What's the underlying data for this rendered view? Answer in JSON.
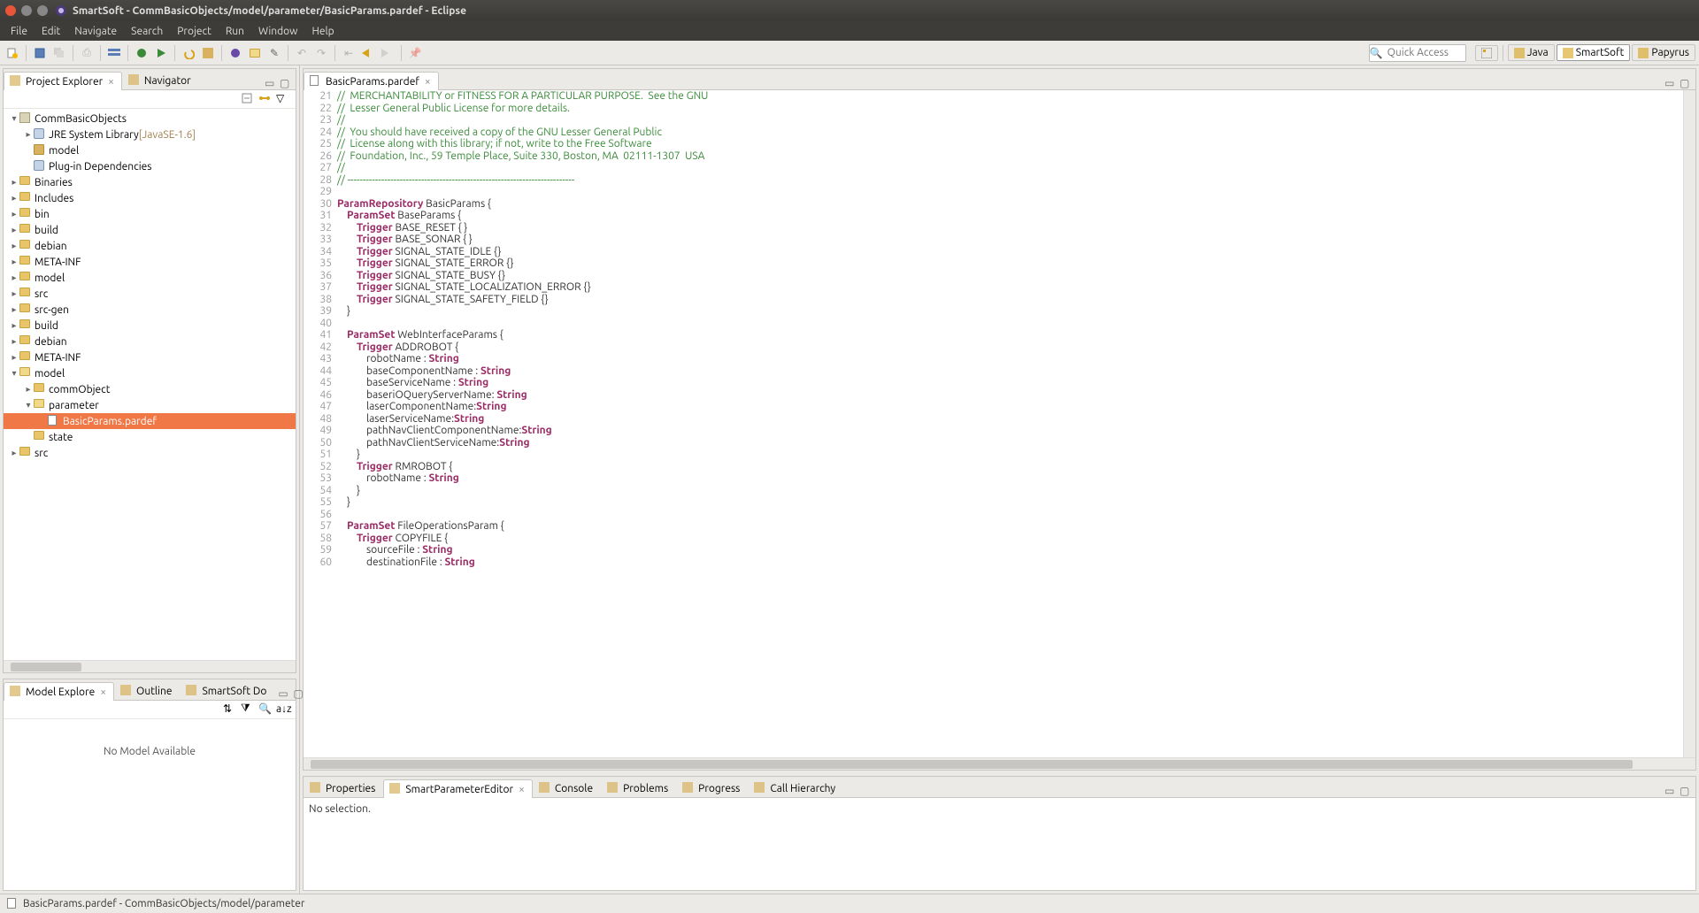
{
  "window": {
    "title": "SmartSoft - CommBasicObjects/model/parameter/BasicParams.pardef - Eclipse"
  },
  "menu": [
    "File",
    "Edit",
    "Navigate",
    "Search",
    "Project",
    "Run",
    "Window",
    "Help"
  ],
  "quickaccess_placeholder": "Quick Access",
  "perspectives": [
    {
      "name": "Java",
      "active": false
    },
    {
      "name": "SmartSoft",
      "active": true
    },
    {
      "name": "Papyrus",
      "active": false
    }
  ],
  "left_top_tabs": [
    {
      "label": "Project Explorer",
      "active": true,
      "closable": true
    },
    {
      "label": "Navigator",
      "active": false,
      "closable": false
    }
  ],
  "tree": [
    {
      "d": 0,
      "tw": "▾",
      "icon": "proj",
      "label": "CommBasicObjects"
    },
    {
      "d": 1,
      "tw": "▸",
      "icon": "jar",
      "label": "JRE System Library",
      "suffix": "[JavaSE-1.6]"
    },
    {
      "d": 1,
      "tw": "",
      "icon": "pkg",
      "label": "model"
    },
    {
      "d": 1,
      "tw": "",
      "icon": "jar",
      "label": "Plug-in Dependencies"
    },
    {
      "d": 0,
      "tw": "▸",
      "icon": "folder",
      "label": "Binaries"
    },
    {
      "d": 0,
      "tw": "▸",
      "icon": "folder",
      "label": "Includes"
    },
    {
      "d": 0,
      "tw": "▸",
      "icon": "folder",
      "label": "bin"
    },
    {
      "d": 0,
      "tw": "▸",
      "icon": "folder",
      "label": "build"
    },
    {
      "d": 0,
      "tw": "▸",
      "icon": "folder",
      "label": "debian"
    },
    {
      "d": 0,
      "tw": "▸",
      "icon": "folder",
      "label": "META-INF"
    },
    {
      "d": 0,
      "tw": "▸",
      "icon": "folder",
      "label": "model"
    },
    {
      "d": 0,
      "tw": "▸",
      "icon": "folder",
      "label": "src"
    },
    {
      "d": 0,
      "tw": "▸",
      "icon": "folder",
      "label": "src-gen"
    },
    {
      "d": 0,
      "tw": "▸",
      "icon": "folder",
      "label": "build"
    },
    {
      "d": 0,
      "tw": "▸",
      "icon": "folder",
      "label": "debian"
    },
    {
      "d": 0,
      "tw": "▸",
      "icon": "folder",
      "label": "META-INF"
    },
    {
      "d": 0,
      "tw": "▾",
      "icon": "folder-open",
      "label": "model"
    },
    {
      "d": 1,
      "tw": "▸",
      "icon": "folder",
      "label": "commObject"
    },
    {
      "d": 1,
      "tw": "▾",
      "icon": "folder-open",
      "label": "parameter"
    },
    {
      "d": 2,
      "tw": "",
      "icon": "file",
      "label": "BasicParams.pardef",
      "selected": true
    },
    {
      "d": 1,
      "tw": "",
      "icon": "folder",
      "label": "state"
    },
    {
      "d": 0,
      "tw": "▸",
      "icon": "folder",
      "label": "src"
    }
  ],
  "left_bottom_tabs": [
    {
      "label": "Model Explore",
      "active": true,
      "closable": true
    },
    {
      "label": "Outline",
      "active": false,
      "closable": false
    },
    {
      "label": "SmartSoft Do",
      "active": false,
      "closable": false
    }
  ],
  "model_explorer_text": "No Model Available",
  "editor_tab": "BasicParams.pardef",
  "code_lines": [
    {
      "n": 21,
      "html": "<span class='cm'>//  MERCHANTABILITY or FITNESS FOR A PARTICULAR PURPOSE.  See the GNU</span>"
    },
    {
      "n": 22,
      "html": "<span class='cm'>//  Lesser General Public License for more details.</span>"
    },
    {
      "n": 23,
      "html": "<span class='cm'>//</span>"
    },
    {
      "n": 24,
      "html": "<span class='cm'>//  You should have received a copy of the GNU Lesser General Public</span>"
    },
    {
      "n": 25,
      "html": "<span class='cm'>//  License along with this library; if not, write to the Free Software</span>"
    },
    {
      "n": 26,
      "html": "<span class='cm'>//  Foundation, Inc., 59 Temple Place, Suite 330, Boston, MA  02111-1307  USA</span>"
    },
    {
      "n": 27,
      "html": "<span class='cm'>//</span>"
    },
    {
      "n": 28,
      "html": "<span class='cm'>// --------------------------------------------------------------------------</span>"
    },
    {
      "n": 29,
      "html": ""
    },
    {
      "n": 30,
      "fold": true,
      "html": "<span class='kw'>ParamRepository</span> BasicParams {"
    },
    {
      "n": 31,
      "fold": true,
      "html": "    <span class='kw'>ParamSet</span> BaseParams {"
    },
    {
      "n": 32,
      "html": "        <span class='kw'>Trigger</span> BASE_RESET { }"
    },
    {
      "n": 33,
      "html": "        <span class='kw'>Trigger</span> BASE_SONAR { }"
    },
    {
      "n": 34,
      "html": "        <span class='kw'>Trigger</span> SIGNAL_STATE_IDLE {}"
    },
    {
      "n": 35,
      "html": "        <span class='kw'>Trigger</span> SIGNAL_STATE_ERROR {}"
    },
    {
      "n": 36,
      "html": "        <span class='kw'>Trigger</span> SIGNAL_STATE_BUSY {}"
    },
    {
      "n": 37,
      "html": "        <span class='kw'>Trigger</span> SIGNAL_STATE_LOCALIZATION_ERROR {}"
    },
    {
      "n": 38,
      "html": "        <span class='kw'>Trigger</span> SIGNAL_STATE_SAFETY_FIELD {}"
    },
    {
      "n": 39,
      "html": "    }"
    },
    {
      "n": 40,
      "html": ""
    },
    {
      "n": 41,
      "fold": true,
      "html": "    <span class='kw'>ParamSet</span> WebInterfaceParams {"
    },
    {
      "n": 42,
      "fold": true,
      "html": "        <span class='kw'>Trigger</span> ADDROBOT {"
    },
    {
      "n": 43,
      "html": "            robotName : <span class='ty'>String</span>"
    },
    {
      "n": 44,
      "html": "            baseComponentName : <span class='ty'>String</span>"
    },
    {
      "n": 45,
      "html": "            baseServiceName : <span class='ty'>String</span>"
    },
    {
      "n": 46,
      "html": "            baseriOQueryServerName: <span class='ty'>String</span>"
    },
    {
      "n": 47,
      "html": "            laserComponentName:<span class='ty'>String</span>"
    },
    {
      "n": 48,
      "html": "            laserServiceName:<span class='ty'>String</span>"
    },
    {
      "n": 49,
      "html": "            pathNavClientComponentName:<span class='ty'>String</span>"
    },
    {
      "n": 50,
      "html": "            pathNavClientServiceName:<span class='ty'>String</span>"
    },
    {
      "n": 51,
      "html": "        }"
    },
    {
      "n": 52,
      "fold": true,
      "html": "        <span class='kw'>Trigger</span> RMROBOT {"
    },
    {
      "n": 53,
      "html": "            robotName : <span class='ty'>String</span>"
    },
    {
      "n": 54,
      "html": "        }"
    },
    {
      "n": 55,
      "html": "    }"
    },
    {
      "n": 56,
      "html": ""
    },
    {
      "n": 57,
      "fold": true,
      "html": "    <span class='kw'>ParamSet</span> FileOperationsParam {"
    },
    {
      "n": 58,
      "fold": true,
      "html": "        <span class='kw'>Trigger</span> COPYFILE {"
    },
    {
      "n": 59,
      "html": "            sourceFile : <span class='ty'>String</span>"
    },
    {
      "n": 60,
      "html": "            destinationFile : <span class='ty'>String</span>"
    }
  ],
  "bottom_tabs": [
    {
      "label": "Properties",
      "active": false
    },
    {
      "label": "SmartParameterEditor",
      "active": true,
      "closable": true
    },
    {
      "label": "Console",
      "active": false
    },
    {
      "label": "Problems",
      "active": false
    },
    {
      "label": "Progress",
      "active": false
    },
    {
      "label": "Call Hierarchy",
      "active": false
    }
  ],
  "bottom_body": "No selection.",
  "status_text": "BasicParams.pardef - CommBasicObjects/model/parameter"
}
